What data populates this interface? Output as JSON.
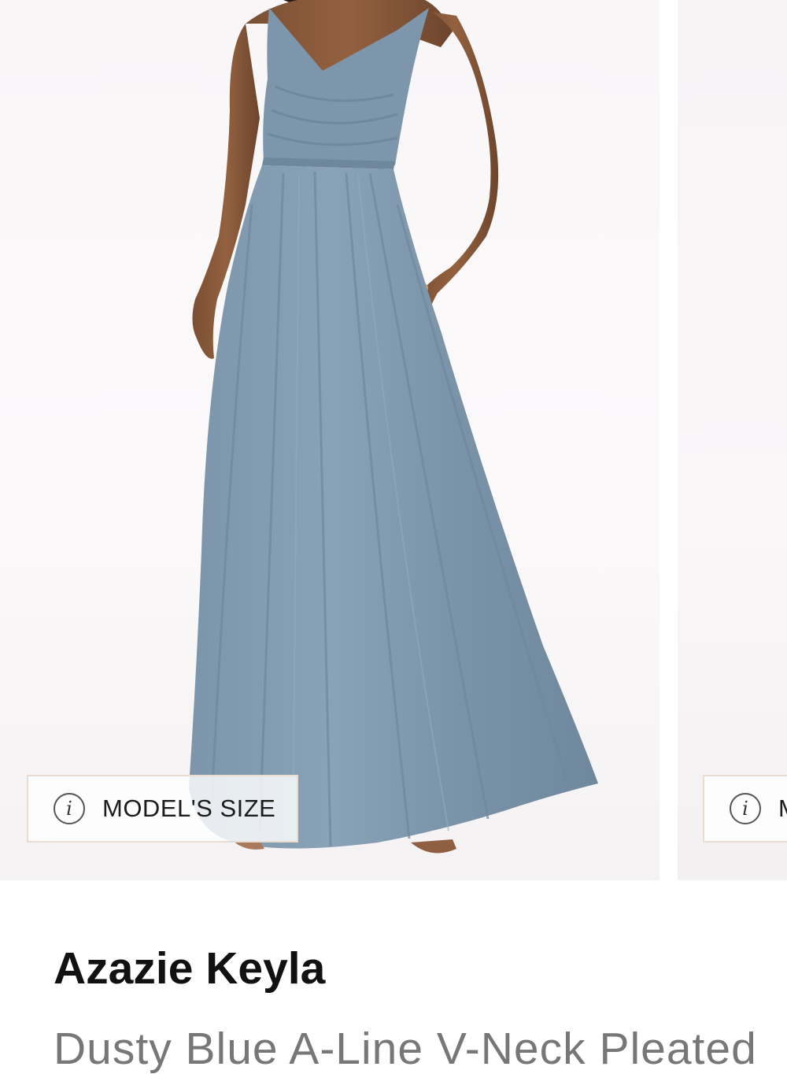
{
  "product": {
    "name": "Azazie Keyla",
    "description": "Dusty Blue A-Line V-Neck Pleated"
  },
  "gallery": {
    "slides": [
      {
        "alt": "Model wearing dusty blue chiffon gown",
        "badge_label": "MODEL'S SIZE",
        "badge_icon": "info-icon"
      },
      {
        "alt": "Second product photo",
        "badge_label": "MODEL'S SIZE",
        "badge_icon": "info-icon"
      }
    ]
  },
  "colors": {
    "dress": "#7f98ad",
    "background": "#f8f6f7",
    "badge_border": "#e9ddd3"
  }
}
